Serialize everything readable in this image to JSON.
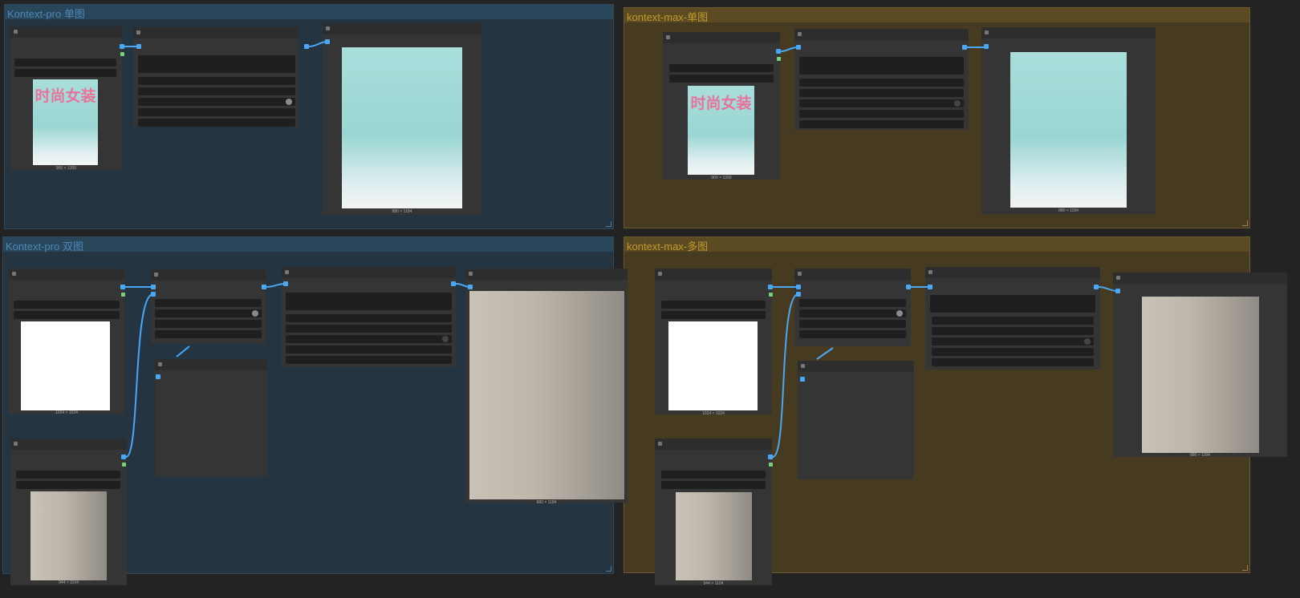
{
  "groups": {
    "pro_single": {
      "title": "Kontext-pro 单图"
    },
    "max_single": {
      "title": "kontext-max-单图"
    },
    "pro_dual": {
      "title": "Kontext-pro 双图"
    },
    "max_multi": {
      "title": "kontext-max-多图"
    }
  },
  "images": {
    "pro_single_input": {
      "caption": "900 × 1200",
      "overlay": "时尚女装"
    },
    "pro_single_output": {
      "caption": "880 × 1184"
    },
    "max_single_input": {
      "caption": "900 × 1200",
      "overlay": "时尚女装"
    },
    "max_single_output": {
      "caption": "880 × 1184"
    },
    "pro_dual_bag": {
      "caption": "1024 × 1024"
    },
    "pro_dual_woman": {
      "caption": "944 × 1104"
    },
    "pro_dual_output": {
      "caption": "880 × 1184"
    },
    "max_multi_bag": {
      "caption": "1024 × 1024"
    },
    "max_multi_woman": {
      "caption": "944 × 1104"
    },
    "max_multi_output": {
      "caption": "880 × 1184"
    }
  },
  "colors": {
    "blue_group": "#253441",
    "gold_group": "#463b20",
    "wire": "#4aa7f5",
    "node": "#353535"
  },
  "icons": {
    "node_collapse": "collapse-dot-icon",
    "slot": "square-slot-icon",
    "toggle": "circle-toggle-icon"
  }
}
